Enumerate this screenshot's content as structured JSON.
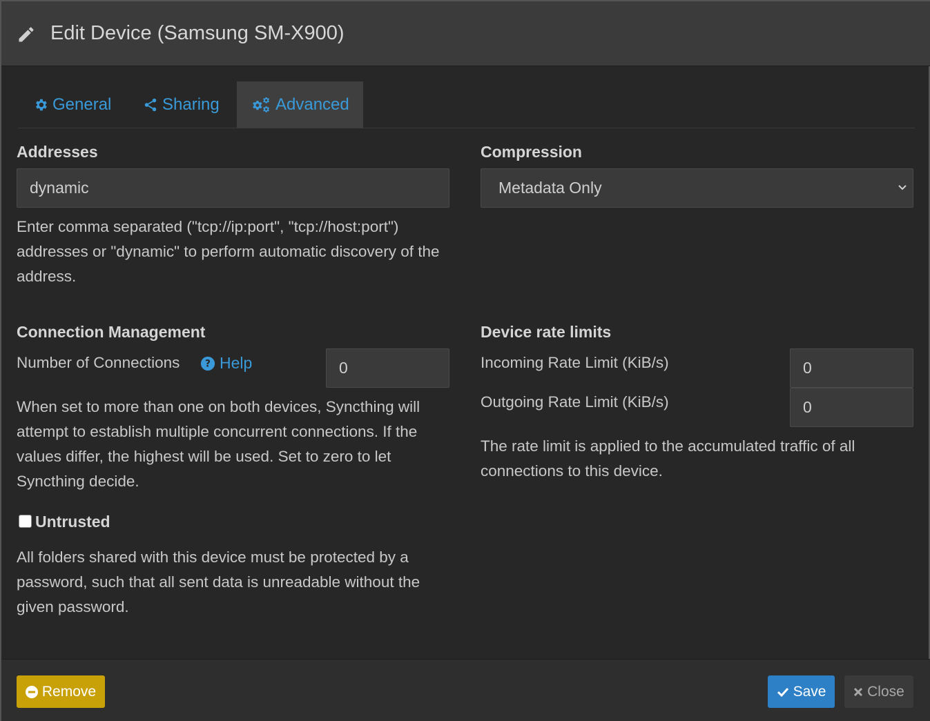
{
  "header": {
    "title": "Edit Device (Samsung SM-X900)"
  },
  "tabs": [
    {
      "label": "General",
      "icon": "gear-icon"
    },
    {
      "label": "Sharing",
      "icon": "share-icon"
    },
    {
      "label": "Advanced",
      "icon": "gears-icon",
      "active": true
    }
  ],
  "addresses": {
    "label": "Addresses",
    "value": "dynamic",
    "help": "Enter comma separated (\"tcp://ip:port\", \"tcp://host:port\") addresses or \"dynamic\" to perform automatic discovery of the address."
  },
  "compression": {
    "label": "Compression",
    "selected": "Metadata Only"
  },
  "connection_management": {
    "heading": "Connection Management",
    "num_connections_label": "Number of Connections",
    "help_link": "Help",
    "num_connections_value": "0",
    "help": "When set to more than one on both devices, Syncthing will attempt to establish multiple concurrent connections. If the values differ, the highest will be used. Set to zero to let Syncthing decide."
  },
  "untrusted": {
    "label": "Untrusted",
    "checked": false,
    "help": "All folders shared with this device must be protected by a password, such that all sent data is unreadable without the given password."
  },
  "rate_limits": {
    "heading": "Device rate limits",
    "incoming_label": "Incoming Rate Limit (KiB/s)",
    "incoming_value": "0",
    "outgoing_label": "Outgoing Rate Limit (KiB/s)",
    "outgoing_value": "0",
    "help": "The rate limit is applied to the accumulated traffic of all connections to this device."
  },
  "footer": {
    "remove_label": "Remove",
    "save_label": "Save",
    "close_label": "Close"
  },
  "colors": {
    "accent": "#3a9ad9",
    "remove": "#c8a008",
    "save": "#2d7fc6"
  }
}
